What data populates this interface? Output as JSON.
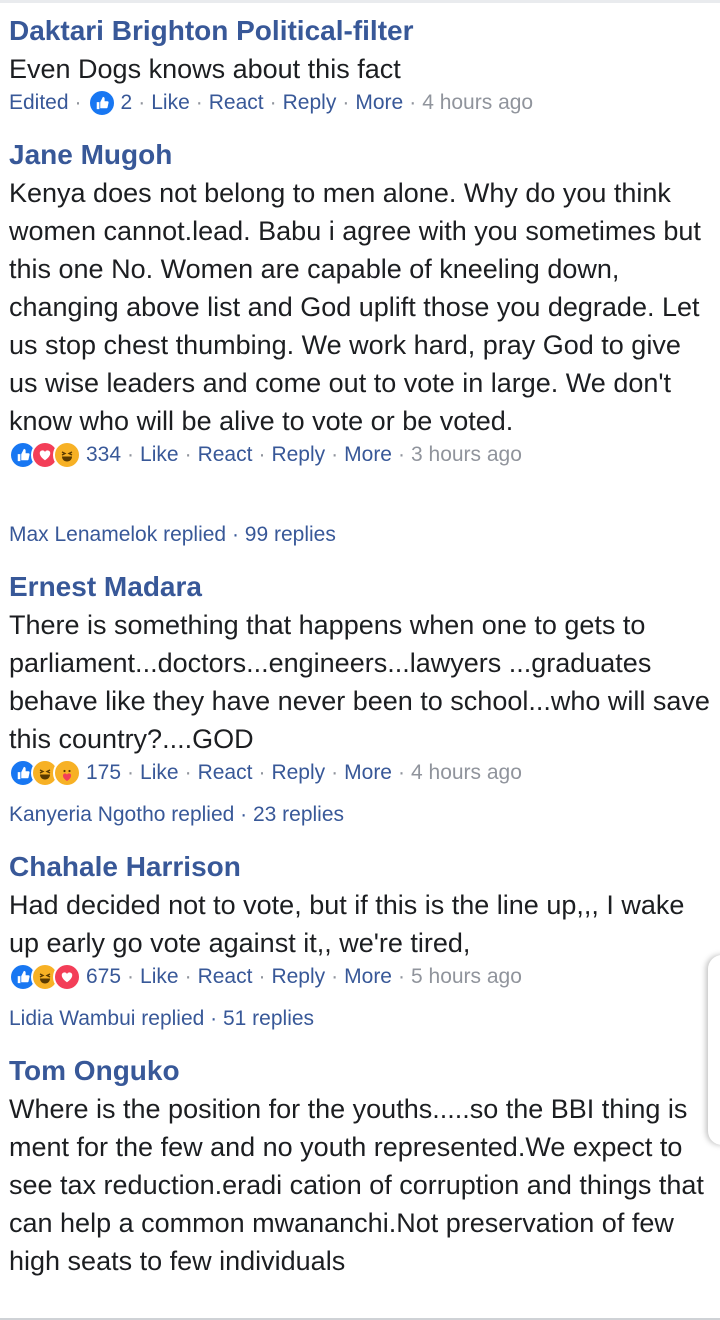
{
  "comments": [
    {
      "author": "Daktari Brighton Political-filter",
      "text": "Even Dogs knows about this fact",
      "edited": "Edited",
      "reaction_count": "2",
      "reactions": [
        "like"
      ],
      "like": "Like",
      "react": "React",
      "reply": "Reply",
      "more": "More",
      "time": "4 hours ago"
    },
    {
      "author": "Jane Mugoh",
      "text": "Kenya does not belong to men alone. Why do you think women cannot.lead. Babu i agree with you sometimes but this one No. Women are capable of kneeling down, changing above list and God uplift those you degrade. Let us stop chest thumbing. We work hard, pray God to give us wise leaders and come out to vote in large. We don't know who will be alive to vote or be voted.",
      "reaction_count": "334",
      "reactions": [
        "like",
        "love",
        "haha"
      ],
      "like": "Like",
      "react": "React",
      "reply": "Reply",
      "more": "More",
      "time": "3 hours ago",
      "replies": "Max Lenamelok replied · 99 replies"
    },
    {
      "author": "Ernest Madara",
      "text": "There is something that happens when one to gets to parliament...doctors...engineers...lawyers ...graduates behave like they have never been to school...who will save this country?....GOD",
      "reaction_count": "175",
      "reactions": [
        "like",
        "haha",
        "care"
      ],
      "like": "Like",
      "react": "React",
      "reply": "Reply",
      "more": "More",
      "time": "4 hours ago",
      "replies": "Kanyeria Ngotho replied · 23 replies"
    },
    {
      "author": "Chahale Harrison",
      "text": "Had decided not to vote, but if this is the line up,,, I wake up early go vote against it,, we're tired,",
      "reaction_count": "675",
      "reactions": [
        "like",
        "haha",
        "love"
      ],
      "like": "Like",
      "react": "React",
      "reply": "Reply",
      "more": "More",
      "time": "5 hours ago",
      "replies": "Lidia Wambui replied · 51 replies"
    },
    {
      "author": "Tom Onguko",
      "text": "Where is the position for the youths.....so the BBI thing is ment for the few and no youth represented.We expect to see tax reduction.eradi cation of corruption and things that can help a common mwananchi.Not preservation of few high seats to few individuals"
    }
  ],
  "colors": {
    "link": "#385898",
    "text": "#1c1e21",
    "meta": "#90949c",
    "like": "#1877f2",
    "love": "#f33e58",
    "haha": "#f7b125"
  },
  "icons": {
    "like": "thumbs-up-icon",
    "love": "heart-icon",
    "haha": "laughing-face-icon",
    "care": "care-face-icon"
  }
}
